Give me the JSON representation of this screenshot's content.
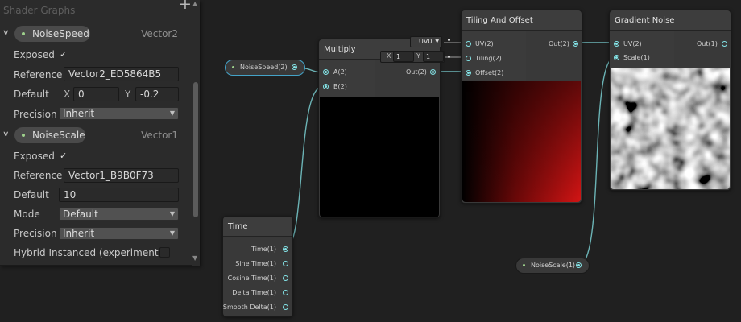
{
  "blackboard": {
    "title": "Shader Graphs",
    "add_icon": "+",
    "properties": [
      {
        "name": "NoiseSpeed",
        "type": "Vector2",
        "exposed_label": "Exposed",
        "exposed_check": "✓",
        "reference_label": "Reference",
        "reference_value": "Vector2_ED5864B5",
        "default_label": "Default",
        "x_label": "X",
        "x_value": "0",
        "y_label": "Y",
        "y_value": "-0.2",
        "precision_label": "Precision",
        "precision_value": "Inherit"
      },
      {
        "name": "NoiseScale",
        "type": "Vector1",
        "exposed_label": "Exposed",
        "exposed_check": "✓",
        "reference_label": "Reference",
        "reference_value": "Vector1_B9B0F73",
        "default_label": "Default",
        "default_value": "10",
        "mode_label": "Mode",
        "mode_value": "Default",
        "precision_label": "Precision",
        "precision_value": "Inherit",
        "hybrid_label": "Hybrid Instanced (experimental)"
      }
    ]
  },
  "nodes": {
    "noise_speed_prop": {
      "label": "NoiseSpeed(2)"
    },
    "noise_scale_prop": {
      "label": "NoiseScale(1)"
    },
    "multiply": {
      "title": "Multiply",
      "inputs": [
        "A(2)",
        "B(2)"
      ],
      "output": "Out(2)"
    },
    "tiling_offset": {
      "title": "Tiling And Offset",
      "inputs": [
        "UV(2)",
        "Tiling(2)",
        "Offset(2)"
      ],
      "output": "Out(2)",
      "uv_dropdown": "UV0",
      "tiling_x_label": "X",
      "tiling_x": "1",
      "tiling_y_label": "Y",
      "tiling_y": "1"
    },
    "gradient_noise": {
      "title": "Gradient Noise",
      "inputs": [
        "UV(2)",
        "Scale(1)"
      ],
      "output": "Out(1)"
    },
    "time": {
      "title": "Time",
      "outputs": [
        "Time(1)",
        "Sine Time(1)",
        "Cosine Time(1)",
        "Delta Time(1)",
        "Smooth Delta(1)"
      ]
    }
  },
  "colors": {
    "vector2_port": "#84e4e7",
    "property_dot": "#9ed18c",
    "selection_outline": "#44a3c8",
    "tiling_preview_red": "#d21414"
  },
  "icons": {
    "foldout": "chevron-down-icon",
    "add": "plus-icon",
    "dropdown": "triangle-down-icon"
  }
}
